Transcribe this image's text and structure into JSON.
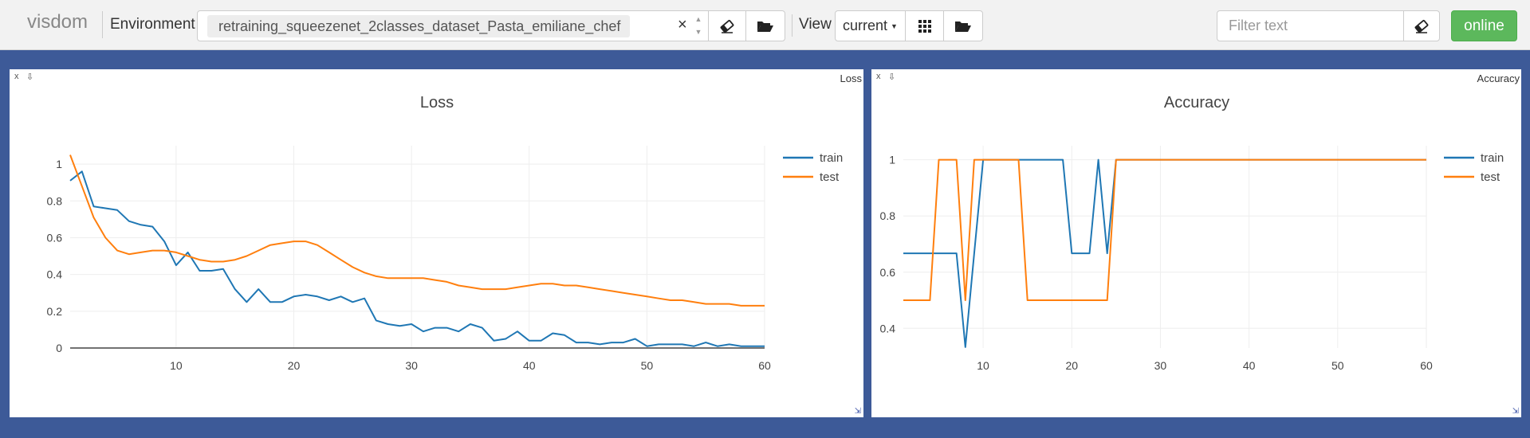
{
  "topbar": {
    "logo": "visdom",
    "environment_label": "Environment",
    "environment_value": "retraining_squeezenet_2classes_dataset_Pasta_emiliane_chef",
    "environment_clear": "×",
    "view_label": "View",
    "view_value": "current",
    "filter_placeholder": "Filter text",
    "status": "online",
    "status_color": "#5cb85c",
    "icons": [
      "eraser-icon",
      "folder-open-icon",
      "grid-icon",
      "folder-open-icon",
      "eraser-icon"
    ]
  },
  "panes": [
    {
      "tag": "Loss",
      "close": "x",
      "download": "⇩"
    },
    {
      "tag": "Accuracy",
      "close": "x",
      "download": "⇩"
    }
  ],
  "chart_data": [
    {
      "type": "line",
      "title": "Loss",
      "xlabel": "",
      "ylabel": "",
      "xlim": [
        1,
        60
      ],
      "ylim": [
        0,
        1.1
      ],
      "xticks": [
        10,
        20,
        30,
        40,
        50,
        60
      ],
      "yticks": [
        0,
        0.2,
        0.4,
        0.6,
        0.8,
        1
      ],
      "grid": true,
      "legend": "top-right",
      "series": [
        {
          "name": "train",
          "color": "#1f77b4",
          "x": [
            1,
            2,
            3,
            4,
            5,
            6,
            7,
            8,
            9,
            10,
            11,
            12,
            13,
            14,
            15,
            16,
            17,
            18,
            19,
            20,
            21,
            22,
            23,
            24,
            25,
            26,
            27,
            28,
            29,
            30,
            31,
            32,
            33,
            34,
            35,
            36,
            37,
            38,
            39,
            40,
            41,
            42,
            43,
            44,
            45,
            46,
            47,
            48,
            49,
            50,
            51,
            52,
            53,
            54,
            55,
            56,
            57,
            58,
            59,
            60
          ],
          "values": [
            0.91,
            0.96,
            0.77,
            0.76,
            0.75,
            0.69,
            0.67,
            0.66,
            0.58,
            0.45,
            0.52,
            0.42,
            0.42,
            0.43,
            0.32,
            0.25,
            0.32,
            0.25,
            0.25,
            0.28,
            0.29,
            0.28,
            0.26,
            0.28,
            0.25,
            0.27,
            0.15,
            0.13,
            0.12,
            0.13,
            0.09,
            0.11,
            0.11,
            0.09,
            0.13,
            0.11,
            0.04,
            0.05,
            0.09,
            0.04,
            0.04,
            0.08,
            0.07,
            0.03,
            0.03,
            0.02,
            0.03,
            0.03,
            0.05,
            0.01,
            0.02,
            0.02,
            0.02,
            0.01,
            0.03,
            0.01,
            0.02,
            0.01,
            0.01,
            0.01
          ]
        },
        {
          "name": "test",
          "color": "#ff7f0e",
          "x": [
            1,
            2,
            3,
            4,
            5,
            6,
            7,
            8,
            9,
            10,
            11,
            12,
            13,
            14,
            15,
            16,
            17,
            18,
            19,
            20,
            21,
            22,
            23,
            24,
            25,
            26,
            27,
            28,
            29,
            30,
            31,
            32,
            33,
            34,
            35,
            36,
            37,
            38,
            39,
            40,
            41,
            42,
            43,
            44,
            45,
            46,
            47,
            48,
            49,
            50,
            51,
            52,
            53,
            54,
            55,
            56,
            57,
            58,
            59,
            60
          ],
          "values": [
            1.05,
            0.88,
            0.71,
            0.6,
            0.53,
            0.51,
            0.52,
            0.53,
            0.53,
            0.52,
            0.5,
            0.48,
            0.47,
            0.47,
            0.48,
            0.5,
            0.53,
            0.56,
            0.57,
            0.58,
            0.58,
            0.56,
            0.52,
            0.48,
            0.44,
            0.41,
            0.39,
            0.38,
            0.38,
            0.38,
            0.38,
            0.37,
            0.36,
            0.34,
            0.33,
            0.32,
            0.32,
            0.32,
            0.33,
            0.34,
            0.35,
            0.35,
            0.34,
            0.34,
            0.33,
            0.32,
            0.31,
            0.3,
            0.29,
            0.28,
            0.27,
            0.26,
            0.26,
            0.25,
            0.24,
            0.24,
            0.24,
            0.23,
            0.23,
            0.23
          ]
        }
      ]
    },
    {
      "type": "line",
      "title": "Accuracy",
      "xlabel": "",
      "ylabel": "",
      "xlim": [
        1,
        60
      ],
      "ylim": [
        0.33,
        1.05
      ],
      "xticks": [
        10,
        20,
        30,
        40,
        50,
        60
      ],
      "yticks": [
        0.4,
        0.6,
        0.8,
        1
      ],
      "grid": true,
      "legend": "top-right",
      "series": [
        {
          "name": "train",
          "color": "#1f77b4",
          "x": [
            1,
            2,
            3,
            4,
            5,
            6,
            7,
            8,
            9,
            10,
            11,
            12,
            13,
            14,
            15,
            16,
            17,
            18,
            19,
            20,
            21,
            22,
            23,
            24,
            25,
            26,
            27,
            28,
            29,
            30,
            31,
            32,
            33,
            34,
            35,
            36,
            37,
            38,
            39,
            40,
            41,
            42,
            43,
            44,
            45,
            46,
            47,
            48,
            49,
            50,
            51,
            52,
            53,
            54,
            55,
            56,
            57,
            58,
            59,
            60
          ],
          "values": [
            0.667,
            0.667,
            0.667,
            0.667,
            0.667,
            0.667,
            0.667,
            0.333,
            0.667,
            1,
            1,
            1,
            1,
            1,
            1,
            1,
            1,
            1,
            1,
            0.667,
            0.667,
            0.667,
            1,
            0.667,
            1,
            1,
            1,
            1,
            1,
            1,
            1,
            1,
            1,
            1,
            1,
            1,
            1,
            1,
            1,
            1,
            1,
            1,
            1,
            1,
            1,
            1,
            1,
            1,
            1,
            1,
            1,
            1,
            1,
            1,
            1,
            1,
            1,
            1,
            1,
            1
          ]
        },
        {
          "name": "test",
          "color": "#ff7f0e",
          "x": [
            1,
            2,
            3,
            4,
            5,
            6,
            7,
            8,
            9,
            10,
            11,
            12,
            13,
            14,
            15,
            16,
            17,
            18,
            19,
            20,
            21,
            22,
            23,
            24,
            25,
            26,
            27,
            28,
            29,
            30,
            31,
            32,
            33,
            34,
            35,
            36,
            37,
            38,
            39,
            40,
            41,
            42,
            43,
            44,
            45,
            46,
            47,
            48,
            49,
            50,
            51,
            52,
            53,
            54,
            55,
            56,
            57,
            58,
            59,
            60
          ],
          "values": [
            0.5,
            0.5,
            0.5,
            0.5,
            1,
            1,
            1,
            0.5,
            1,
            1,
            1,
            1,
            1,
            1,
            0.5,
            0.5,
            0.5,
            0.5,
            0.5,
            0.5,
            0.5,
            0.5,
            0.5,
            0.5,
            1,
            1,
            1,
            1,
            1,
            1,
            1,
            1,
            1,
            1,
            1,
            1,
            1,
            1,
            1,
            1,
            1,
            1,
            1,
            1,
            1,
            1,
            1,
            1,
            1,
            1,
            1,
            1,
            1,
            1,
            1,
            1,
            1,
            1,
            1,
            1
          ]
        }
      ]
    }
  ]
}
